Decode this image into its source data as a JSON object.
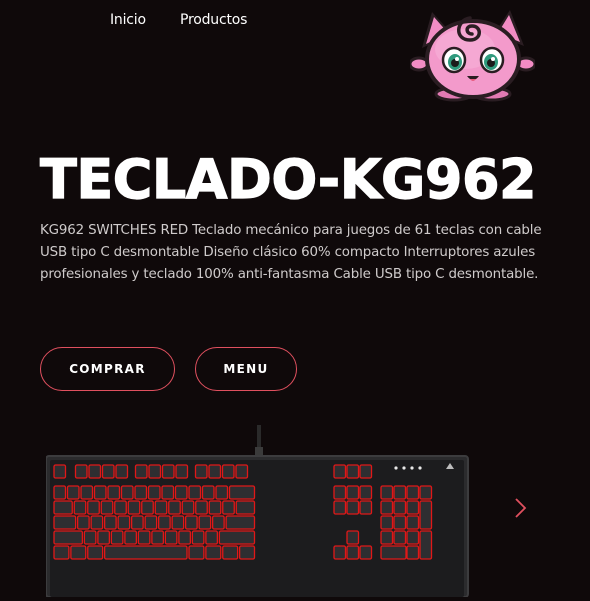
{
  "nav": {
    "items": [
      {
        "label": "Inicio"
      },
      {
        "label": "Productos"
      }
    ]
  },
  "logo": {
    "icon": "jigglypuff-mascot-icon"
  },
  "hero": {
    "title": "TECLADO-KG962",
    "description": "KG962 SWITCHES RED Teclado mecánico para juegos de 61 teclas con cable USB tipo C desmontable Diseño clásico 60% compacto Interruptores azules profesionales y teclado 100% anti-fantasma Cable USB tipo C desmontable.",
    "buttons": {
      "buy": "COMPRAR",
      "menu": "MENU"
    }
  },
  "product": {
    "image": "mechanical-keyboard-red-backlight",
    "next_icon": "chevron-right-icon"
  },
  "colors": {
    "background": "#0f090a",
    "accent": "#e0505f",
    "text": "#ffffff",
    "muted_text": "#cfcbcb",
    "key_glow": "#e01818"
  }
}
